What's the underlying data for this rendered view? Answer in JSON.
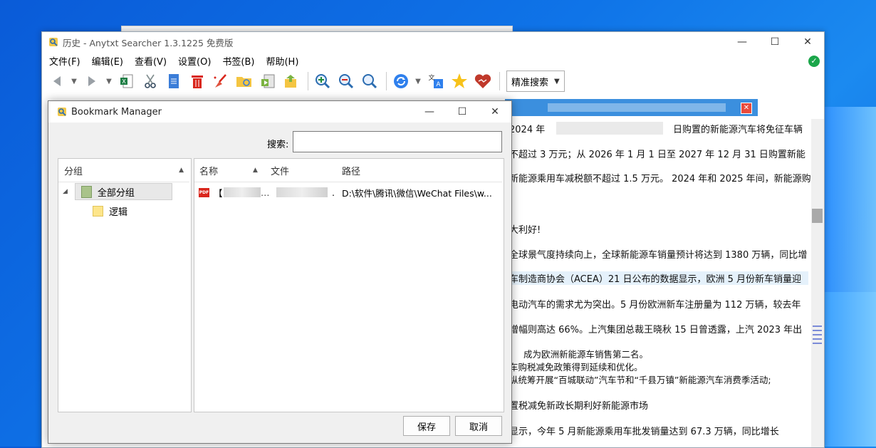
{
  "main_window": {
    "title": "历史 - Anytxt Searcher 1.3.1225 免费版",
    "menu": [
      "文件(F)",
      "编辑(E)",
      "查看(V)",
      "设置(O)",
      "书签(B)",
      "帮助(H)"
    ],
    "search_mode": "精准搜索"
  },
  "document": {
    "lines": [
      "2024 年",
      "日购置的新能源汽车将免征车辆",
      "不超过 3 万元；从 2026 年 1 月 1 日至 2027 年 12 月 31 日购置新能",
      "新能源乘用车减税额不超过 1.5 万元。 2024 年和 2025 年间，新能源购",
      "大利好!",
      "全球景气度持续向上，全球新能源车销量预计将达到 1380 万辆，同比增",
      "车制造商协会（ACEA）21 日公布的数据显示，欧洲 5 月份新车销量迎",
      "电动汽车的需求尤为突出。5 月份欧洲新车注册量为 112 万辆，较去年",
      "增幅则高达 66%。上汽集团总裁王晓秋 15 日曾透露，上汽 2023 年出",
      "成为欧洲新能源车销售第二名。",
      "车购税减免政策得到延续和优化。",
      "纵统筹开展“百城联动”汽车节和“千县万镇”新能源汽车消费季活动;",
      "置税减免新政长期利好新能源市场",
      "显示，今年 5 月新能源乘用车批发销量达到 67.3 万辆，同比增长"
    ]
  },
  "dialog": {
    "title": "Bookmark Manager",
    "search_label": "搜索:",
    "search_value": "",
    "groups_header": "分组",
    "groups": [
      {
        "label": "全部分组",
        "selected": true
      },
      {
        "label": "逻辑",
        "selected": false
      }
    ],
    "columns": {
      "name": "名称",
      "file": "文件",
      "path": "路径"
    },
    "rows": [
      {
        "name": "【",
        "file": ".",
        "path": "D:\\软件\\腾讯\\微信\\WeChat Files\\w..."
      }
    ],
    "save_label": "保存",
    "cancel_label": "取消"
  }
}
